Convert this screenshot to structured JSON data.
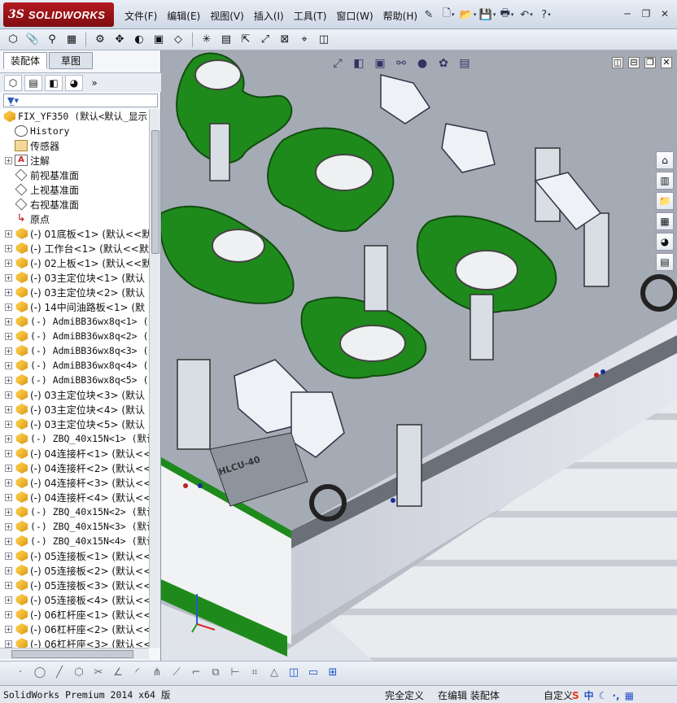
{
  "app": {
    "logo_ds": "3S",
    "logo_name": "SOLIDWORKS"
  },
  "menu": [
    "文件(F)",
    "编辑(E)",
    "视图(V)",
    "插入(I)",
    "工具(T)",
    "窗口(W)",
    "帮助(H)"
  ],
  "manager_tabs": [
    "装配体",
    "草图"
  ],
  "tree_root": "FIX_YF350  (默认<默认_显示",
  "tree_items": [
    {
      "icon": "history-icon",
      "label": "History",
      "mono": true
    },
    {
      "icon": "sensor-icon",
      "label": "传感器"
    },
    {
      "icon": "annotation-icon",
      "label": "注解",
      "expand": true
    },
    {
      "icon": "plane-icon",
      "label": "前视基准面"
    },
    {
      "icon": "plane-icon",
      "label": "上视基准面"
    },
    {
      "icon": "plane-icon",
      "label": "右视基准面"
    },
    {
      "icon": "origin-icon",
      "label": "原点"
    },
    {
      "icon": "part-icon",
      "label": "(-) 01底板<1> (默认<<默",
      "expand": true
    },
    {
      "icon": "part-icon",
      "label": "(-) 工作台<1> (默认<<默",
      "expand": true
    },
    {
      "icon": "part-icon",
      "label": "(-) 02上板<1> (默认<<默",
      "expand": true
    },
    {
      "icon": "part-icon",
      "label": "(-) 03主定位块<1> (默认",
      "expand": true
    },
    {
      "icon": "part-icon",
      "label": "(-) 03主定位块<2> (默认",
      "expand": true
    },
    {
      "icon": "part-icon",
      "label": "(-) 14中间油路板<1> (默",
      "expand": true
    },
    {
      "icon": "part-icon",
      "label": "(-) AdmiBB36wx8q<1> (默",
      "expand": true,
      "mono": true
    },
    {
      "icon": "part-icon",
      "label": "(-) AdmiBB36wx8q<2> (默",
      "expand": true,
      "mono": true
    },
    {
      "icon": "part-icon",
      "label": "(-) AdmiBB36wx8q<3> (默",
      "expand": true,
      "mono": true
    },
    {
      "icon": "part-icon",
      "label": "(-) AdmiBB36wx8q<4> (默",
      "expand": true,
      "mono": true
    },
    {
      "icon": "part-icon",
      "label": "(-) AdmiBB36wx8q<5> (默",
      "expand": true,
      "mono": true
    },
    {
      "icon": "part-icon",
      "label": "(-) 03主定位块<3> (默认",
      "expand": true
    },
    {
      "icon": "part-icon",
      "label": "(-) 03主定位块<4> (默认",
      "expand": true
    },
    {
      "icon": "part-icon",
      "label": "(-) 03主定位块<5> (默认",
      "expand": true
    },
    {
      "icon": "part-icon",
      "label": "(-) ZBQ_40x15N<1> (默认",
      "expand": true,
      "mono": true
    },
    {
      "icon": "part-icon",
      "label": "(-) 04连接杆<1> (默认<<",
      "expand": true
    },
    {
      "icon": "part-icon",
      "label": "(-) 04连接杆<2> (默认<<",
      "expand": true
    },
    {
      "icon": "part-icon",
      "label": "(-) 04连接杆<3> (默认<<",
      "expand": true
    },
    {
      "icon": "part-icon",
      "label": "(-) 04连接杆<4> (默认<<",
      "expand": true
    },
    {
      "icon": "part-icon",
      "label": "(-) ZBQ_40x15N<2> (默认",
      "expand": true,
      "mono": true
    },
    {
      "icon": "part-icon",
      "label": "(-) ZBQ_40x15N<3> (默认",
      "expand": true,
      "mono": true
    },
    {
      "icon": "part-icon",
      "label": "(-) ZBQ_40x15N<4> (默认",
      "expand": true,
      "mono": true
    },
    {
      "icon": "part-icon",
      "label": "(-) 05连接板<1> (默认<<",
      "expand": true
    },
    {
      "icon": "part-icon",
      "label": "(-) 05连接板<2> (默认<<",
      "expand": true
    },
    {
      "icon": "part-icon",
      "label": "(-) 05连接板<3> (默认<<",
      "expand": true
    },
    {
      "icon": "part-icon",
      "label": "(-) 05连接板<4> (默认<<",
      "expand": true
    },
    {
      "icon": "part-icon",
      "label": "(-) 06杠杆座<1> (默认<<",
      "expand": true
    },
    {
      "icon": "part-icon",
      "label": "(-) 06杠杆座<2> (默认<<",
      "expand": true
    },
    {
      "icon": "part-icon",
      "label": "(-) 06杠杆座<3> (默认<<",
      "expand": true
    }
  ],
  "model_label": "HLCU-40",
  "status": {
    "product": "SolidWorks Premium 2014 x64 版",
    "state": "完全定义",
    "mode": "在编辑 装配体",
    "custom": "自定义"
  },
  "ime": {
    "s": "S",
    "zh": "中",
    "moon": "☾",
    "dot": "·,",
    "grid": "▦"
  },
  "colors": {
    "accent": "#b51a20",
    "green": "#1f8a1c",
    "steel": "#9fa6b0"
  }
}
